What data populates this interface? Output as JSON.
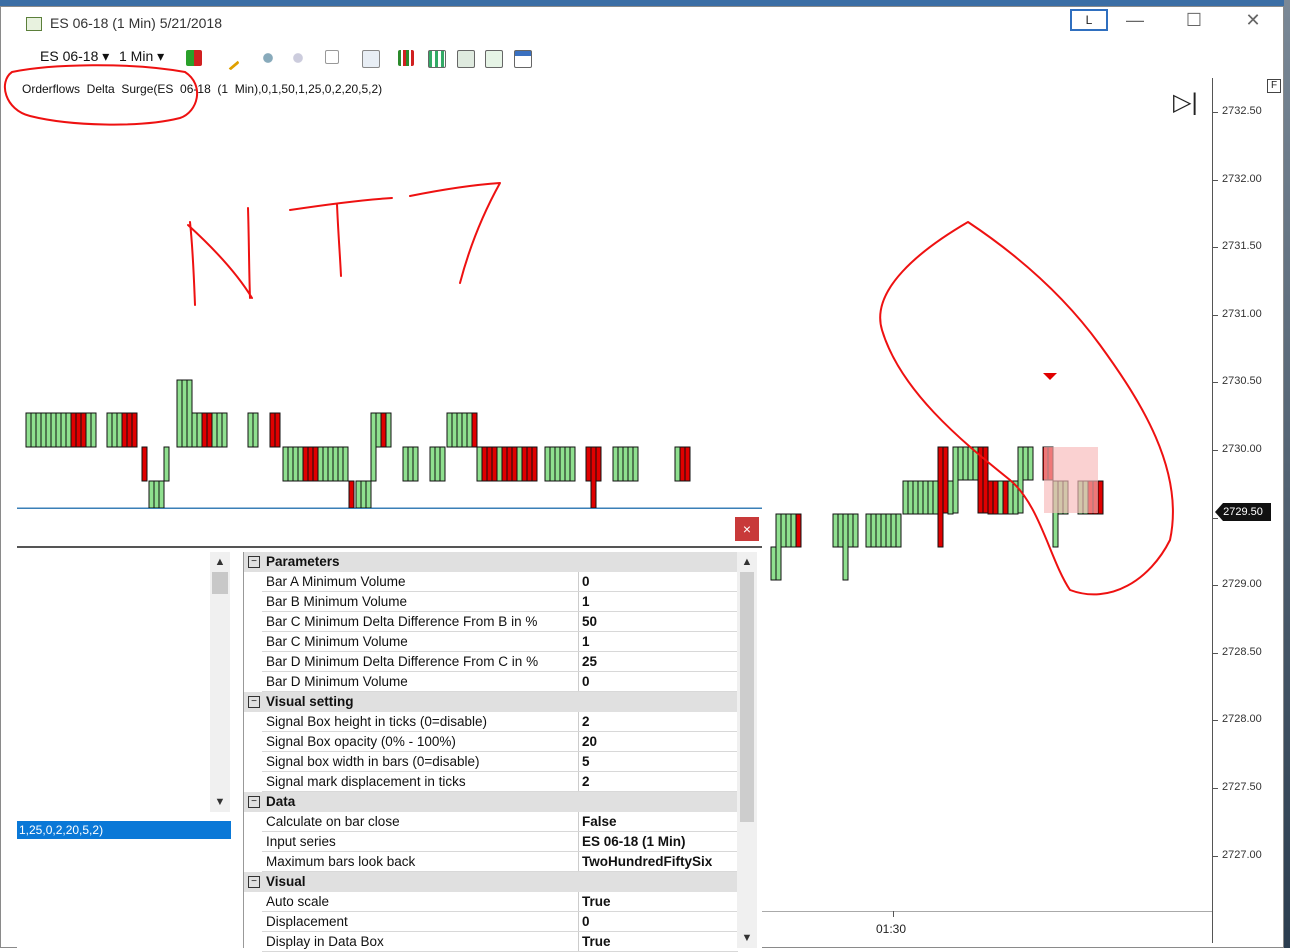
{
  "window": {
    "title": "ES 06-18 (1 Min)  5/21/2018",
    "layout_button": "L",
    "minimize": "—",
    "maximize": "☐",
    "close": "✕"
  },
  "toolbar": {
    "instrument": "ES 06-18",
    "interval": "1 Min",
    "dropdown": "▾"
  },
  "chart": {
    "indicator_label": "Orderflows  Delta  Surge(ES  06-18  (1  Min),0,1,50,1,25,0,2,20,5,2)",
    "annotation_text": "NT7",
    "nav_button": "▷|",
    "f_button": "F",
    "current_price": "2729.50",
    "time_label": "01:30"
  },
  "chart_data": {
    "type": "bar",
    "price_axis": [
      "2732.50",
      "2732.00",
      "2731.50",
      "2731.00",
      "2730.50",
      "2730.00",
      "2729.50",
      "2729.00",
      "2728.50",
      "2728.00",
      "2727.50",
      "2727.00"
    ],
    "current_price": 2729.5,
    "time_axis": [
      "01:30"
    ],
    "colors": {
      "up": "#8fe08f",
      "down": "#e00000",
      "signal_box": "#f7b9b9",
      "annotation": "#ee1111"
    }
  },
  "dialog": {
    "close": "×",
    "selected_item": "1,25,0,2,20,5,2)",
    "scroll_up": "▲",
    "scroll_down": "▼",
    "categories": [
      {
        "name": "Parameters",
        "rows": [
          {
            "name": "Bar A Minimum Volume",
            "value": "0"
          },
          {
            "name": "Bar B Minimum Volume",
            "value": "1"
          },
          {
            "name": "Bar C Minimum Delta Difference From B in %",
            "value": "50"
          },
          {
            "name": "Bar C Minimum Volume",
            "value": "1"
          },
          {
            "name": "Bar D Minimum Delta Difference From C in %",
            "value": "25"
          },
          {
            "name": "Bar D Minimum Volume",
            "value": "0"
          }
        ]
      },
      {
        "name": "Visual setting",
        "rows": [
          {
            "name": "Signal Box height in ticks (0=disable)",
            "value": "2"
          },
          {
            "name": "Signal Box opacity (0% - 100%)",
            "value": "20"
          },
          {
            "name": "Signal box width in bars (0=disable)",
            "value": "5"
          },
          {
            "name": "Signal mark displacement in ticks",
            "value": "2"
          }
        ]
      },
      {
        "name": "Data",
        "rows": [
          {
            "name": "Calculate on bar close",
            "value": "False"
          },
          {
            "name": "Input series",
            "value": "ES 06-18 (1 Min)"
          },
          {
            "name": "Maximum bars look back",
            "value": "TwoHundredFiftySix"
          }
        ]
      },
      {
        "name": "Visual",
        "rows": [
          {
            "name": "Auto scale",
            "value": "True"
          },
          {
            "name": "Displacement",
            "value": "0"
          },
          {
            "name": "Display in Data Box",
            "value": "True"
          }
        ]
      }
    ]
  }
}
